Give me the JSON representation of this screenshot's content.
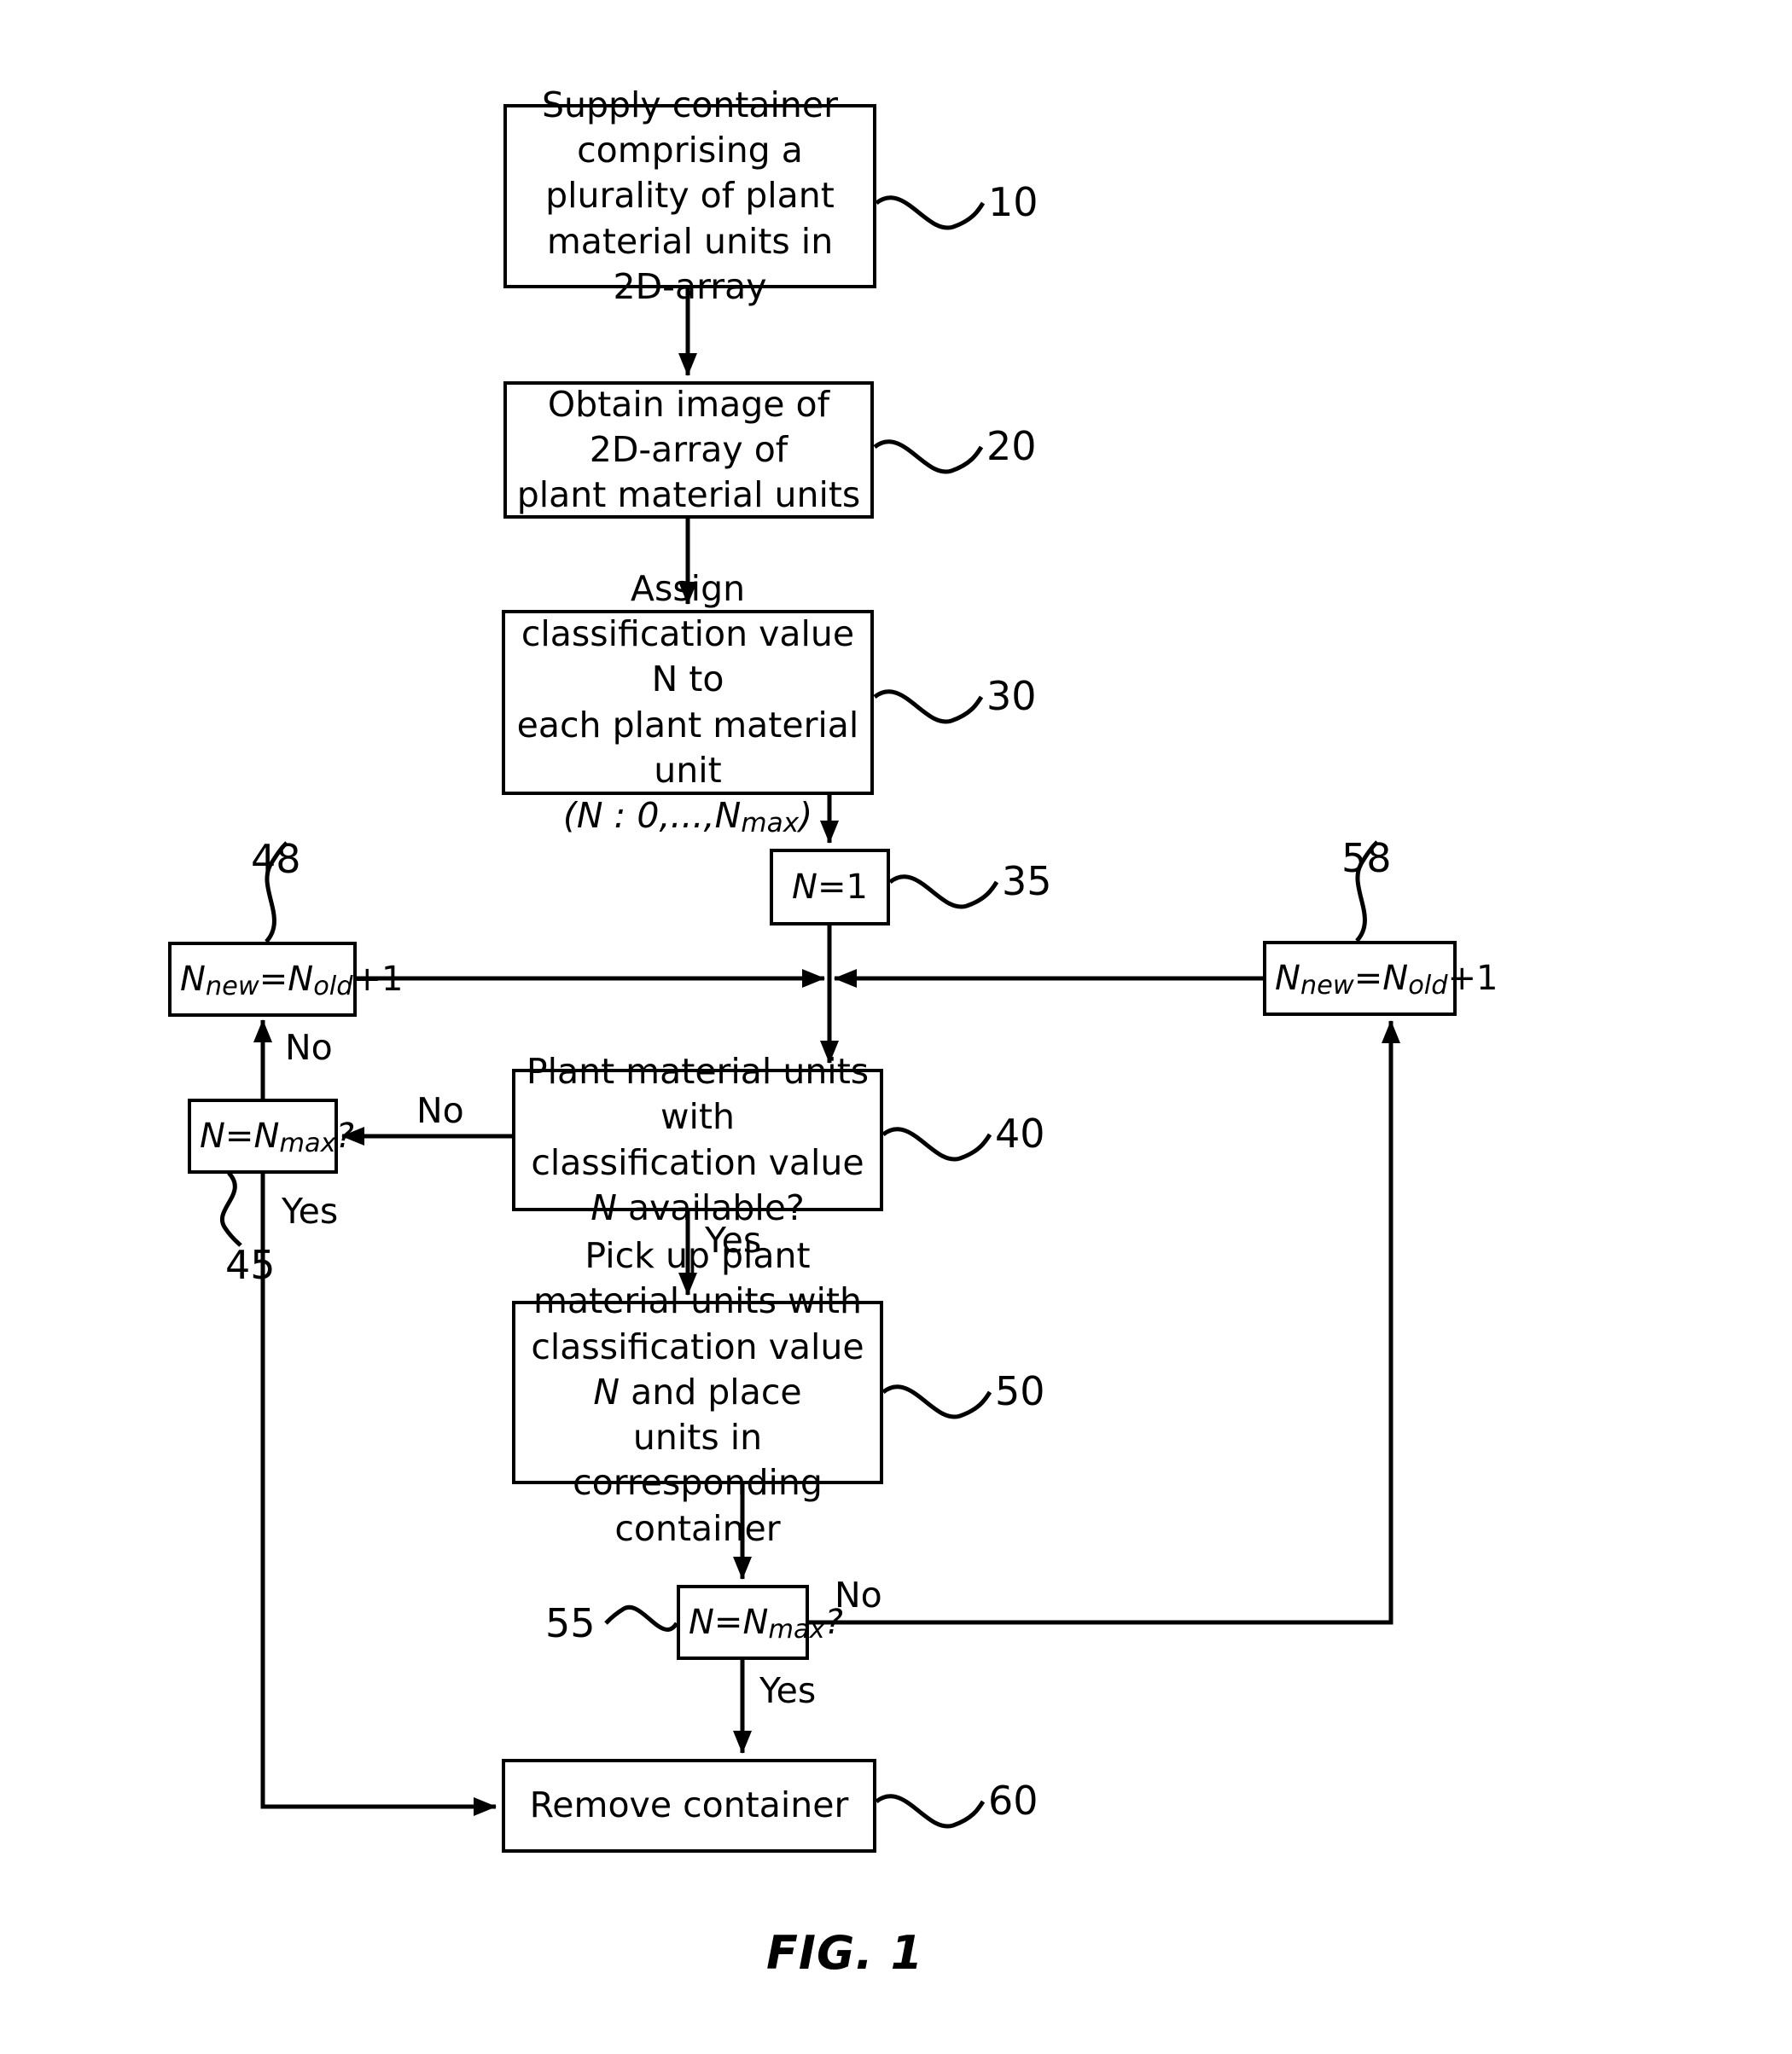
{
  "figure": {
    "caption": "FIG. 1",
    "type": "patent-flowchart"
  },
  "nodes": {
    "supply": {
      "ref": "10",
      "line1": "Supply container comprising a",
      "line2": "plurality of plant material units in",
      "line3": "2D-array"
    },
    "obtain": {
      "ref": "20",
      "line1": "Obtain image of 2D-array of",
      "line2": "plant material units"
    },
    "assign": {
      "ref": "30",
      "line1": "Assign classification value N to",
      "line2": "each plant material unit",
      "line3_open": "(",
      "line3_n": "N",
      "line3_mid": " : 0,...,",
      "line3_nmax_base": "N",
      "line3_nmax_sub": "max",
      "line3_close": ")"
    },
    "init": {
      "ref": "35",
      "n": "N",
      "eq": "=1"
    },
    "incr_left": {
      "ref": "48",
      "base1": "N",
      "sub1": "new",
      "eq": "=",
      "base2": "N",
      "sub2": "old",
      "tail": "+1"
    },
    "incr_right": {
      "ref": "58",
      "base1": "N",
      "sub1": "new",
      "eq": "=",
      "base2": "N",
      "sub2": "old",
      "tail": "+1"
    },
    "check_left": {
      "ref": "45",
      "base1": "N",
      "eq": "=",
      "base2": "N",
      "sub2": "max",
      "tail": "?"
    },
    "available": {
      "ref": "40",
      "line1": "Plant material units with",
      "line2_a": "classification value ",
      "line2_n": "N",
      "line2_b": " available?"
    },
    "pickup": {
      "ref": "50",
      "line1": "Pick up plant material units with",
      "line2_a": "classification value ",
      "line2_n": "N",
      "line2_b": " and place",
      "line3": "units in corresponding container"
    },
    "check_bottom": {
      "ref": "55",
      "base1": "N",
      "eq": "=",
      "base2": "N",
      "sub2": "max",
      "tail": "?"
    },
    "remove": {
      "ref": "60",
      "label": "Remove container"
    }
  },
  "edge_labels": {
    "no_left_up": "No",
    "no_from_40": "No",
    "yes_left_down": "Yes",
    "yes_from_40": "Yes",
    "no_from_55": "No",
    "yes_from_55": "Yes"
  },
  "colors": {
    "stroke": "#000000",
    "background": "#ffffff"
  }
}
